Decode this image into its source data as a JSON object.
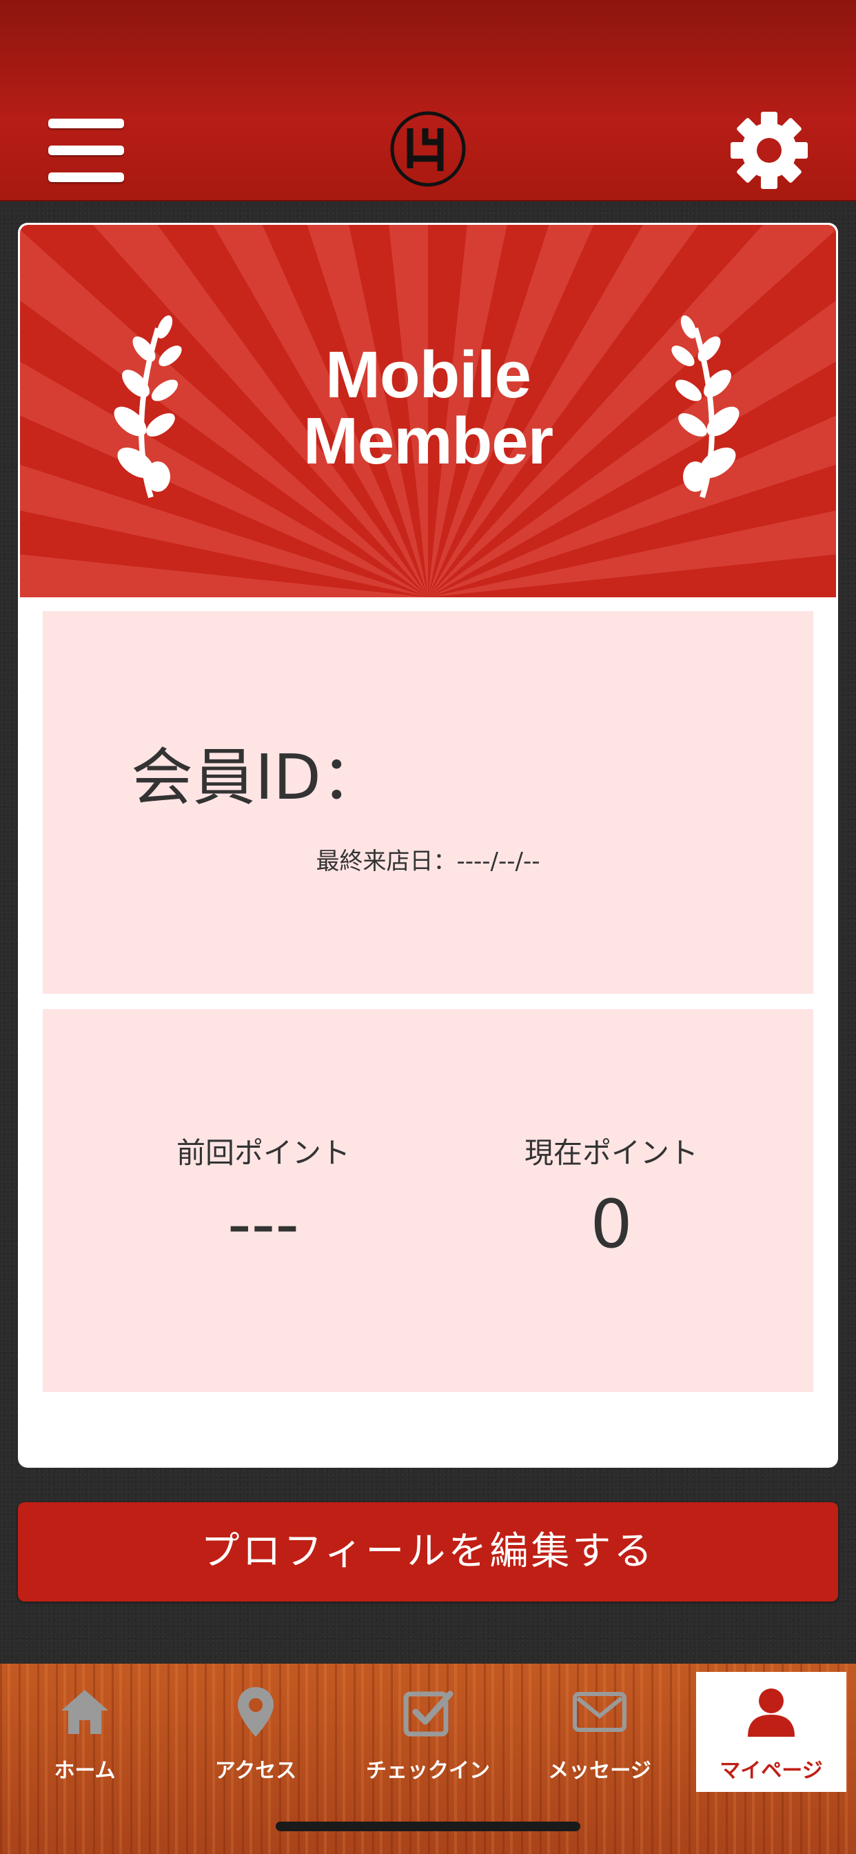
{
  "header": {
    "menu_icon": "hamburger-menu-icon",
    "logo": "brand-logo",
    "settings_icon": "gear-icon",
    "accent_color": "#b61d16"
  },
  "banner": {
    "title_line1": "Mobile",
    "title_line2": "Member"
  },
  "member": {
    "id_label": "会員ID：",
    "id_value": "",
    "last_visit_label": "最終来店日：----/--/--"
  },
  "points": {
    "previous_label": "前回ポイント",
    "previous_value": "---",
    "current_label": "現在ポイント",
    "current_value": "0"
  },
  "actions": {
    "edit_profile": "プロフィールを編集する"
  },
  "tabs": [
    {
      "label": "ホーム",
      "icon": "home-icon",
      "active": false
    },
    {
      "label": "アクセス",
      "icon": "map-pin-icon",
      "active": false
    },
    {
      "label": "チェックイン",
      "icon": "checkbox-icon",
      "active": false
    },
    {
      "label": "メッセージ",
      "icon": "envelope-icon",
      "active": false
    },
    {
      "label": "マイページ",
      "icon": "user-icon",
      "active": true
    }
  ],
  "colors": {
    "button_red": "#c01f15",
    "panel_pink": "#ffe4e4",
    "tab_wood": "#b9501d"
  }
}
